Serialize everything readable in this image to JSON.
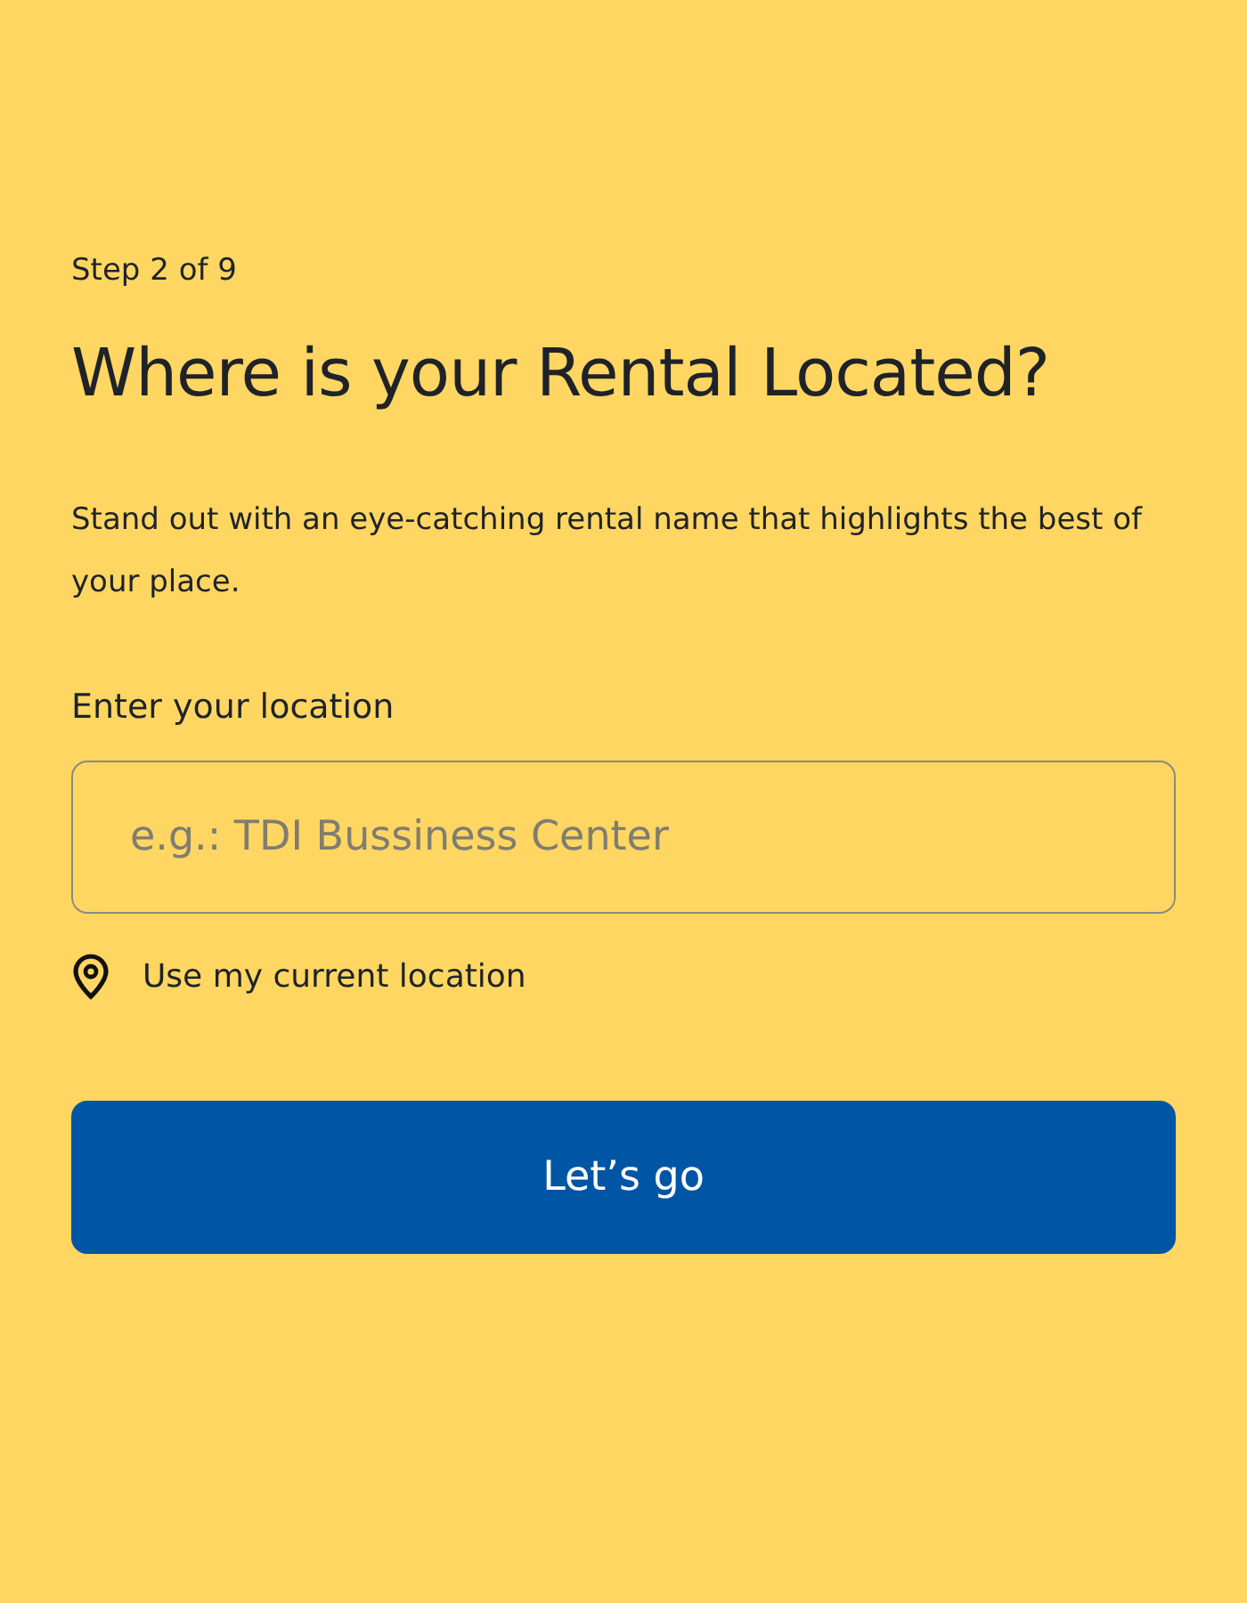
{
  "step": "Step 2 of 9",
  "title": "Where is your Rental Located?",
  "description": "Stand out with an eye-catching rental name that highlights the best of your place.",
  "location_field": {
    "label": "Enter your location",
    "placeholder": "e.g.: TDI Bussiness Center"
  },
  "current_location_link": "Use my current location",
  "submit_button": "Let’s go"
}
